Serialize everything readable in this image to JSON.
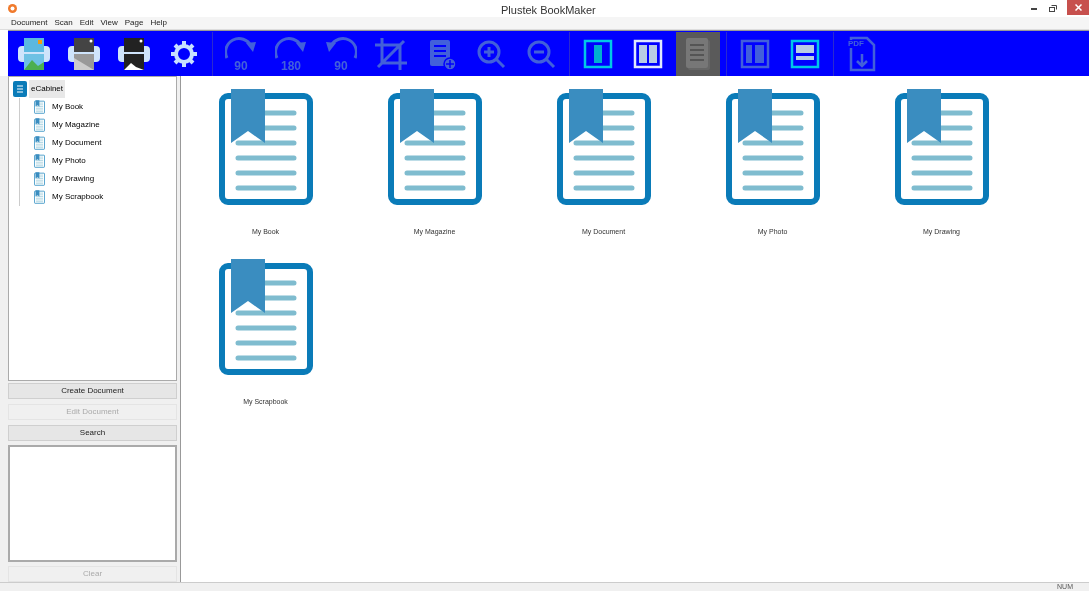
{
  "window": {
    "title": "Plustek BookMaker"
  },
  "menu": [
    "Document",
    "Scan",
    "Edit",
    "View",
    "Page",
    "Help"
  ],
  "toolbar": [
    {
      "kind": "scan-color",
      "disabled": false,
      "selected": false
    },
    {
      "kind": "scan-gray",
      "disabled": false,
      "selected": false
    },
    {
      "kind": "scan-bw",
      "disabled": false,
      "selected": false
    },
    {
      "kind": "settings",
      "disabled": false,
      "selected": false
    },
    {
      "kind": "separator"
    },
    {
      "kind": "rotate-right",
      "label": "90",
      "disabled": true,
      "selected": false
    },
    {
      "kind": "rotate-right",
      "label": "180",
      "disabled": true,
      "selected": false
    },
    {
      "kind": "rotate-left",
      "label": "90",
      "disabled": true,
      "selected": false
    },
    {
      "kind": "crop",
      "disabled": true,
      "selected": false
    },
    {
      "kind": "add-page",
      "disabled": true,
      "selected": false
    },
    {
      "kind": "zoom-in",
      "disabled": true,
      "selected": false
    },
    {
      "kind": "zoom-out",
      "disabled": true,
      "selected": false
    },
    {
      "kind": "separator"
    },
    {
      "kind": "single-page",
      "disabled": false,
      "selected": false
    },
    {
      "kind": "two-page",
      "disabled": false,
      "selected": false
    },
    {
      "kind": "notebook",
      "disabled": false,
      "selected": true
    },
    {
      "kind": "separator"
    },
    {
      "kind": "split-vertical",
      "disabled": true,
      "selected": false
    },
    {
      "kind": "split-horizontal",
      "disabled": false,
      "selected": false
    },
    {
      "kind": "separator"
    },
    {
      "kind": "pdf",
      "label": "PDF",
      "disabled": true,
      "selected": false
    }
  ],
  "tree": {
    "label": "eCabinet",
    "selected": true,
    "children": [
      {
        "label": "My Book",
        "selected": false
      },
      {
        "label": "My Magazine",
        "selected": false
      },
      {
        "label": "My Document",
        "selected": false
      },
      {
        "label": "My Photo",
        "selected": false
      },
      {
        "label": "My Drawing",
        "selected": false
      },
      {
        "label": "My Scrapbook",
        "selected": false
      }
    ]
  },
  "buttons": [
    {
      "label": "Create Document",
      "disabled": false
    },
    {
      "label": "Edit Document",
      "disabled": true
    },
    {
      "label": "Search",
      "disabled": false
    }
  ],
  "clear_button": {
    "label": "Clear",
    "disabled": true
  },
  "documents": [
    "My Book",
    "My Magazine",
    "My Document",
    "My Photo",
    "My Drawing",
    "My Scrapbook"
  ],
  "status_bar": {
    "indicator": "NUM"
  }
}
